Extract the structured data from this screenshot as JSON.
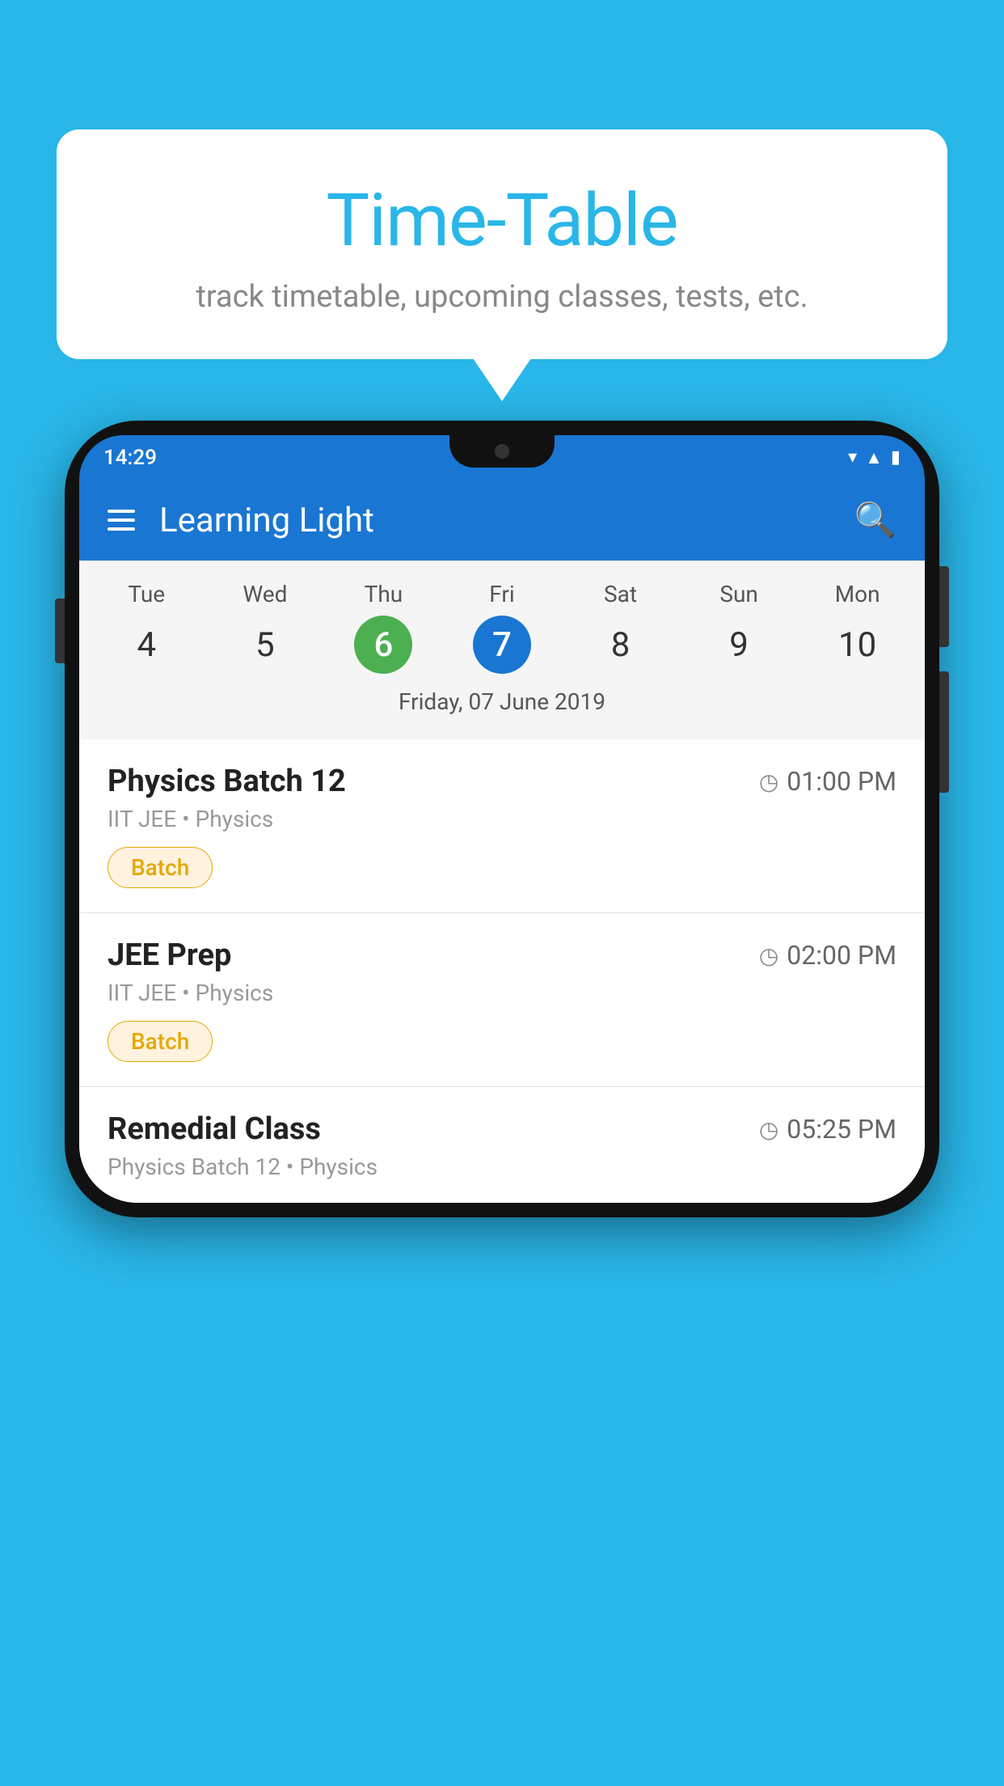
{
  "background_color": "#29b6e8",
  "bubble": {
    "title": "Time-Table",
    "subtitle": "track timetable, upcoming classes, tests, etc."
  },
  "phone": {
    "status_time": "14:29",
    "app_name": "Learning Light",
    "calendar": {
      "days": [
        {
          "name": "Tue",
          "number": "4",
          "state": "normal"
        },
        {
          "name": "Wed",
          "number": "5",
          "state": "normal"
        },
        {
          "name": "Thu",
          "number": "6",
          "state": "today"
        },
        {
          "name": "Fri",
          "number": "7",
          "state": "selected"
        },
        {
          "name": "Sat",
          "number": "8",
          "state": "normal"
        },
        {
          "name": "Sun",
          "number": "9",
          "state": "normal"
        },
        {
          "name": "Mon",
          "number": "10",
          "state": "normal"
        }
      ],
      "selected_date_label": "Friday, 07 June 2019"
    },
    "schedule_items": [
      {
        "title": "Physics Batch 12",
        "time": "01:00 PM",
        "subtitle": "IIT JEE • Physics",
        "badge": "Batch"
      },
      {
        "title": "JEE Prep",
        "time": "02:00 PM",
        "subtitle": "IIT JEE • Physics",
        "badge": "Batch"
      },
      {
        "title": "Remedial Class",
        "time": "05:25 PM",
        "subtitle": "Physics Batch 12 • Physics",
        "badge": null
      }
    ]
  }
}
